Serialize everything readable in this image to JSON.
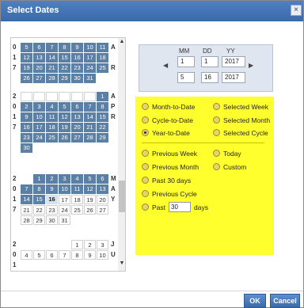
{
  "window": {
    "title": "Select Dates",
    "close_glyph": "×"
  },
  "calendar": {
    "months": [
      {
        "year_digits": [
          "0",
          "1",
          "7"
        ],
        "month_letters": [
          "A",
          "",
          "R"
        ],
        "rows": [
          [
            "5",
            "6",
            "7",
            "8",
            "9",
            "10",
            "11"
          ],
          [
            "12",
            "13",
            "14",
            "15",
            "16",
            "17",
            "18"
          ],
          [
            "19",
            "20",
            "21",
            "22",
            "23",
            "24",
            "25"
          ],
          [
            "26",
            "27",
            "28",
            "29",
            "30",
            "31",
            ""
          ]
        ]
      },
      {
        "year_digits": [
          "2",
          "0",
          "1",
          "7"
        ],
        "month_letters": [
          "A",
          "P",
          "R"
        ],
        "rows": [
          [
            "",
            "",
            "",
            "",
            "",
            "",
            "1"
          ],
          [
            "2",
            "3",
            "4",
            "5",
            "6",
            "7",
            "8"
          ],
          [
            "9",
            "10",
            "11",
            "12",
            "13",
            "14",
            "15"
          ],
          [
            "16",
            "17",
            "18",
            "19",
            "20",
            "21",
            "22"
          ],
          [
            "23",
            "24",
            "25",
            "26",
            "27",
            "28",
            "29"
          ],
          [
            "30",
            "",
            "",
            "",
            "",
            "",
            ""
          ]
        ]
      },
      {
        "year_digits": [
          "2",
          "0",
          "1",
          "7"
        ],
        "month_letters": [
          "M",
          "A",
          "Y"
        ],
        "rows": [
          [
            "",
            "1",
            "2",
            "3",
            "4",
            "5",
            "6"
          ],
          [
            "7",
            "8",
            "9",
            "10",
            "11",
            "12",
            "13"
          ],
          [
            "14",
            "15",
            "16",
            "17",
            "18",
            "19",
            "20"
          ],
          [
            "21",
            "22",
            "23",
            "24",
            "25",
            "26",
            "27"
          ],
          [
            "28",
            "29",
            "30",
            "31",
            "",
            "",
            ""
          ]
        ]
      },
      {
        "year_digits": [
          "2",
          "0",
          "1"
        ],
        "month_letters": [
          "J",
          "U",
          ""
        ],
        "rows": [
          [
            "",
            "",
            "",
            "",
            "1",
            "2",
            "3"
          ],
          [
            "4",
            "5",
            "6",
            "7",
            "8",
            "9",
            "10"
          ]
        ]
      }
    ]
  },
  "date_range": {
    "headers": {
      "mm": "MM",
      "dd": "DD",
      "yy": "YY"
    },
    "start": {
      "mm": "1",
      "dd": "1",
      "yy": "2017"
    },
    "end": {
      "mm": "5",
      "dd": "16",
      "yy": "2017"
    },
    "prev_glyph": "◀",
    "next_glyph": "▶"
  },
  "options": {
    "left_group_1": [
      "Month-to-Date",
      "Cycle-to-Date",
      "Year-to-Date"
    ],
    "right_group_1": [
      "Selected Week",
      "Selected Month",
      "Selected Cycle"
    ],
    "left_group_2": [
      "Previous Week",
      "Previous Month",
      "Past 30 days",
      "Previous Cycle"
    ],
    "right_group_2": [
      "Today",
      "Custom"
    ],
    "past_prefix": "Past",
    "past_value": "30",
    "past_suffix": "days",
    "selected": "Year-to-Date"
  },
  "buttons": {
    "ok": "OK",
    "cancel": "Cancel"
  },
  "colors": {
    "accent": "#3a6aa8",
    "selected_day": "#5c7fa6",
    "options_bg": "#ffff2e"
  }
}
